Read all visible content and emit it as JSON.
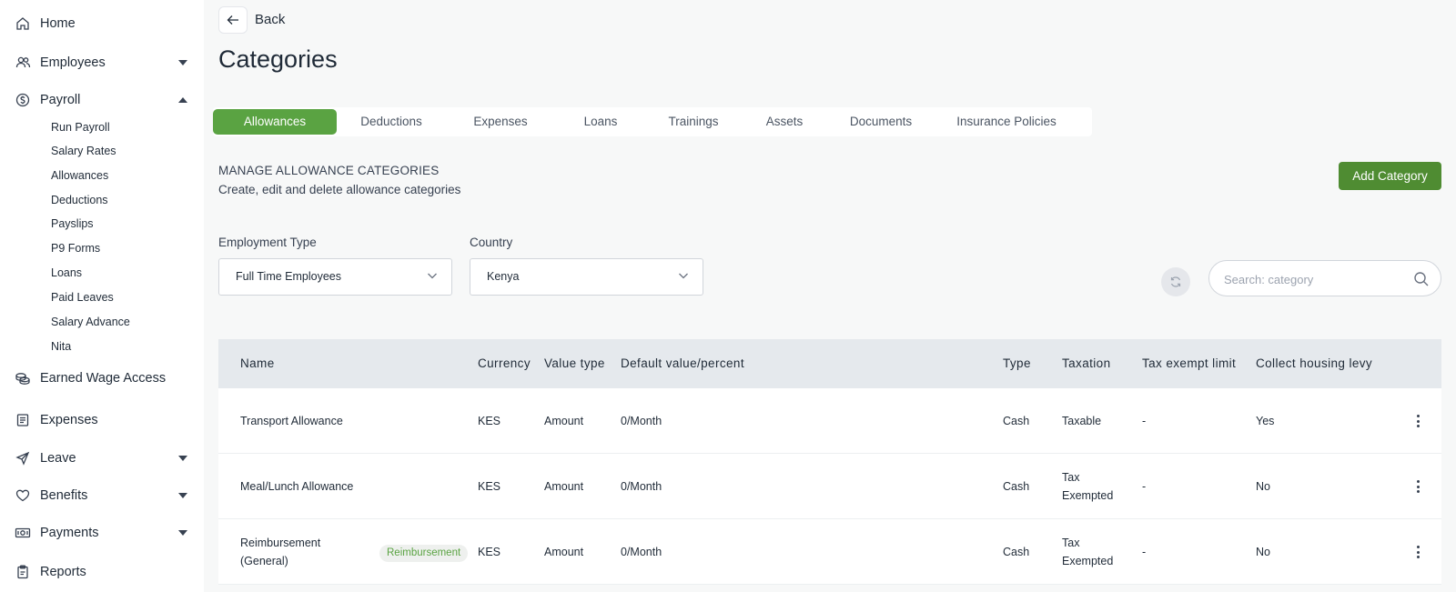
{
  "sidebar": {
    "items": [
      {
        "label": "Home",
        "icon": "home-icon",
        "has_caret": false
      },
      {
        "label": "Employees",
        "icon": "users-icon",
        "has_caret": true,
        "expanded": false
      },
      {
        "label": "Payroll",
        "icon": "dollar-circle-icon",
        "has_caret": true,
        "expanded": true
      },
      {
        "label": "Earned Wage Access",
        "icon": "coins-icon",
        "has_caret": false
      },
      {
        "label": "Expenses",
        "icon": "receipt-icon",
        "has_caret": false
      },
      {
        "label": "Leave",
        "icon": "plane-icon",
        "has_caret": true,
        "expanded": false
      },
      {
        "label": "Benefits",
        "icon": "heart-icon",
        "has_caret": true,
        "expanded": false
      },
      {
        "label": "Payments",
        "icon": "cash-icon",
        "has_caret": true,
        "expanded": false
      },
      {
        "label": "Reports",
        "icon": "clipboard-icon",
        "has_caret": false
      }
    ],
    "payroll_subitems": [
      "Run Payroll",
      "Salary Rates",
      "Allowances",
      "Deductions",
      "Payslips",
      "P9 Forms",
      "Loans",
      "Paid Leaves",
      "Salary Advance",
      "Nita"
    ]
  },
  "header": {
    "back_label": "Back",
    "title": "Categories"
  },
  "tabs": [
    {
      "label": "Allowances",
      "active": true
    },
    {
      "label": "Deductions",
      "active": false
    },
    {
      "label": "Expenses",
      "active": false
    },
    {
      "label": "Loans",
      "active": false
    },
    {
      "label": "Trainings",
      "active": false
    },
    {
      "label": "Assets",
      "active": false
    },
    {
      "label": "Documents",
      "active": false
    },
    {
      "label": "Insurance Policies",
      "active": false
    }
  ],
  "section": {
    "title": "MANAGE ALLOWANCE CATEGORIES",
    "subtitle": "Create, edit and delete allowance categories",
    "add_button": "Add Category"
  },
  "filters": {
    "employment_type": {
      "label": "Employment Type",
      "value": "Full Time Employees"
    },
    "country": {
      "label": "Country",
      "value": "Kenya"
    },
    "search_placeholder": "Search: category"
  },
  "table": {
    "columns": [
      "Name",
      "Currency",
      "Value type",
      "Default value/percent",
      "Type",
      "Taxation",
      "Tax exempt limit",
      "Collect housing levy"
    ],
    "rows": [
      {
        "name": "Transport Allowance",
        "badge": "",
        "currency": "KES",
        "value_type": "Amount",
        "default_value": "0/Month",
        "type": "Cash",
        "taxation": "Taxable",
        "tax_exempt_limit": "-",
        "housing_levy": "Yes"
      },
      {
        "name": "Meal/Lunch Allowance",
        "badge": "",
        "currency": "KES",
        "value_type": "Amount",
        "default_value": "0/Month",
        "type": "Cash",
        "taxation": "Tax Exempted",
        "tax_exempt_limit": "-",
        "housing_levy": "No"
      },
      {
        "name": "Reimbursement (General)",
        "badge": "Reimbursement",
        "currency": "KES",
        "value_type": "Amount",
        "default_value": "0/Month",
        "type": "Cash",
        "taxation": "Tax Exempted",
        "tax_exempt_limit": "-",
        "housing_levy": "No"
      }
    ]
  },
  "colors": {
    "accent": "#5aa342",
    "primary_button": "#4f8c32",
    "table_header_bg": "#e5e9ed",
    "page_bg": "#f7f8f8"
  }
}
